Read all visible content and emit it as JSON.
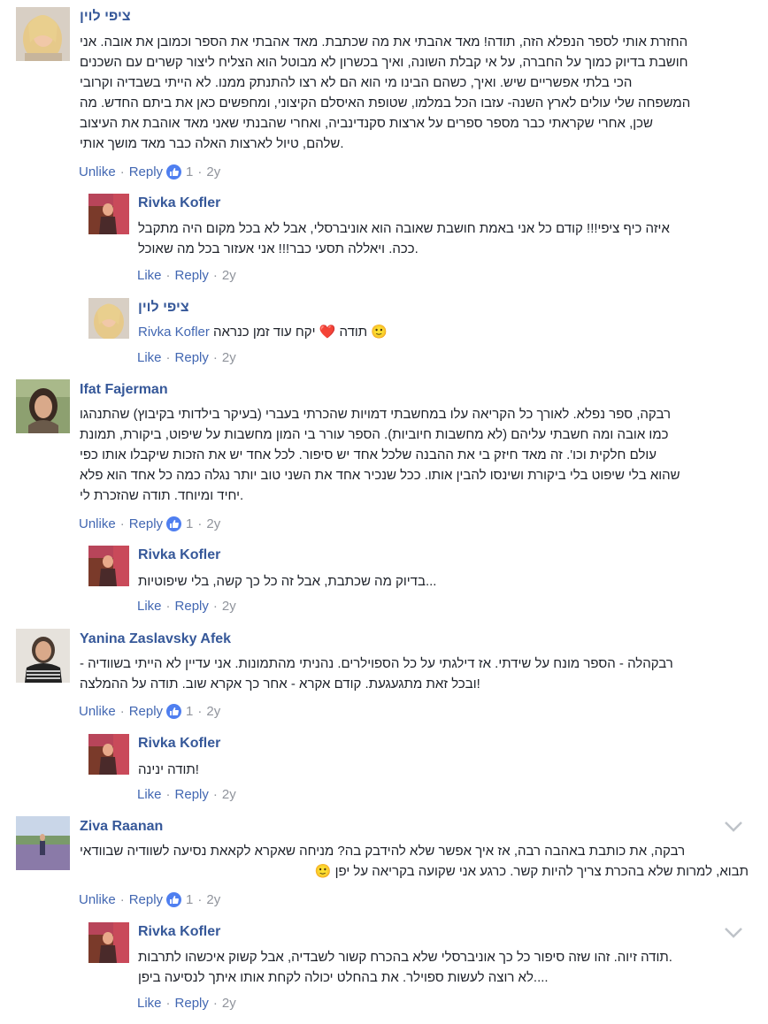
{
  "comments": [
    {
      "author": "ציפי לוין",
      "lines": [
        "החזרת אותי לספר הנפלא הזה, תודה! מאד אהבתי את מה שכתבת. מאד אהבתי את הספר וכמובן את אובה. אני",
        "חושבת בדיוק כמוך על החברה, על אי קבלת השונה, ואיך בכשרון לא מבוטל הוא הצליח ליצור קשרים עם השכנים",
        "הכי בלתי אפשריים שיש. ואיך, כשהם הבינו מי הוא הם לא רצו להתנתק ממנו. לא הייתי בשבדיה וקרובי",
        "המשפחה שלי עולים לארץ השנה- עזבו הכל במלמו, שטופת האיסלם הקיצוני, ומחפשים כאן את ביתם החדש. מה",
        "שכן, אחרי שקראתי כבר מספר ספרים על ארצות סקנדינביה, ואחרי שהבנתי שאני מאד אוהבת את העיצוב",
        ".שלהם, טיול לארצות האלה כבר מאד מושך אותי"
      ],
      "action1": "Unlike",
      "reply": "Reply",
      "like_count": "1",
      "time": "2y",
      "replies": [
        {
          "author": "Rivka Kofler",
          "lines": [
            "איזה כיף ציפי!!! קודם כל אני באמת חושבת שאובה הוא אוניברסלי, אבל לא בכל מקום היה מתקבל",
            ".ככה. ויאללה תסעי כבר!!! אני אעזור בכל מה שאוכל"
          ],
          "action1": "Like",
          "reply": "Reply",
          "time": "2y"
        },
        {
          "author": "ציפי לוין",
          "mention": "Rivka Kofler",
          "text_after": "יקח עוד זמן כנראה",
          "text_end": "תודה",
          "heart": "❤️",
          "smile": "🙂",
          "action1": "Like",
          "reply": "Reply",
          "time": "2y"
        }
      ]
    },
    {
      "author": "Ifat Fajerman",
      "lines": [
        "רבקה, ספר נפלא. לאורך כל הקריאה עלו במחשבתי דמויות שהכרתי בעברי (בעיקר בילדותי בקיבוץ) שהתנהגו",
        "כמו אובה ומה חשבתי עליהם (לא מחשבות חיוביות). הספר עורר בי המון מחשבות על שיפוט, ביקורת, תמונת",
        "עולם חלקית וכו'. זה מאד חיזק בי את ההבנה שלכל אחד יש סיפור. לכל אחד יש את הזכות שיקבלו אותו כפי",
        "שהוא בלי שיפוט בלי ביקורת ושינסו להבין אותו. ככל שנכיר אחד את השני טוב יותר נגלה כמה כל אחד הוא פלא",
        ".יחיד ומיוחד. תודה שהזכרת לי"
      ],
      "action1": "Unlike",
      "reply": "Reply",
      "like_count": "1",
      "time": "2y",
      "replies": [
        {
          "author": "Rivka Kofler",
          "lines": [
            "...בדיוק מה שכתבת, אבל זה כל כך קשה, בלי שיפוטיות"
          ],
          "action1": "Like",
          "reply": "Reply",
          "time": "2y"
        }
      ]
    },
    {
      "author": "Yanina Zaslavsky Afek",
      "lines": [
        "רבקהלה - הספר מונח על שידתי. אז דילגתי על כל הספוילרים. נהניתי מהתמונות. אני עדיין לא הייתי בשוודיה -",
        "!ובכל זאת מתגעגעת. קודם אקרא - אחר כך אקרא שוב. תודה על ההמלצה"
      ],
      "action1": "Unlike",
      "reply": "Reply",
      "like_count": "1",
      "time": "2y",
      "replies": [
        {
          "author": "Rivka Kofler",
          "lines": [
            "!תודה ינינה"
          ],
          "action1": "Like",
          "reply": "Reply",
          "time": "2y"
        }
      ]
    },
    {
      "author": "Ziva Raanan",
      "lines": [
        "רבקה, את כותבת באהבה רבה, אז איך אפשר שלא להידבק בה? מניחה שאקרא לקאאת נסיעה לשוודיה שבוודאי",
        "תבוא, למרות שלא בהכרת צריך להיות קשר. כרגע אני שקועה בקריאה על יפן"
      ],
      "smile": "🙂",
      "action1": "Unlike",
      "reply": "Reply",
      "like_count": "1",
      "time": "2y",
      "replies": [
        {
          "author": "Rivka Kofler",
          "lines": [
            ".תודה זיוה. זהו שזה סיפור כל כך אוניברסלי שלא בהכרח קשור לשבדיה, אבל קשוק איכשהו לתרבות",
            "....לא רוצה לעשות ספוילר. את בהחלט יכולה לקחת אותו איתך לנסיעה ביפן"
          ],
          "action1": "Like",
          "reply": "Reply",
          "time": "2y"
        }
      ]
    }
  ],
  "colors": {
    "link": "#4267b2",
    "author": "#365899",
    "meta": "#90949c",
    "like_badge": "#4f7ff0"
  }
}
